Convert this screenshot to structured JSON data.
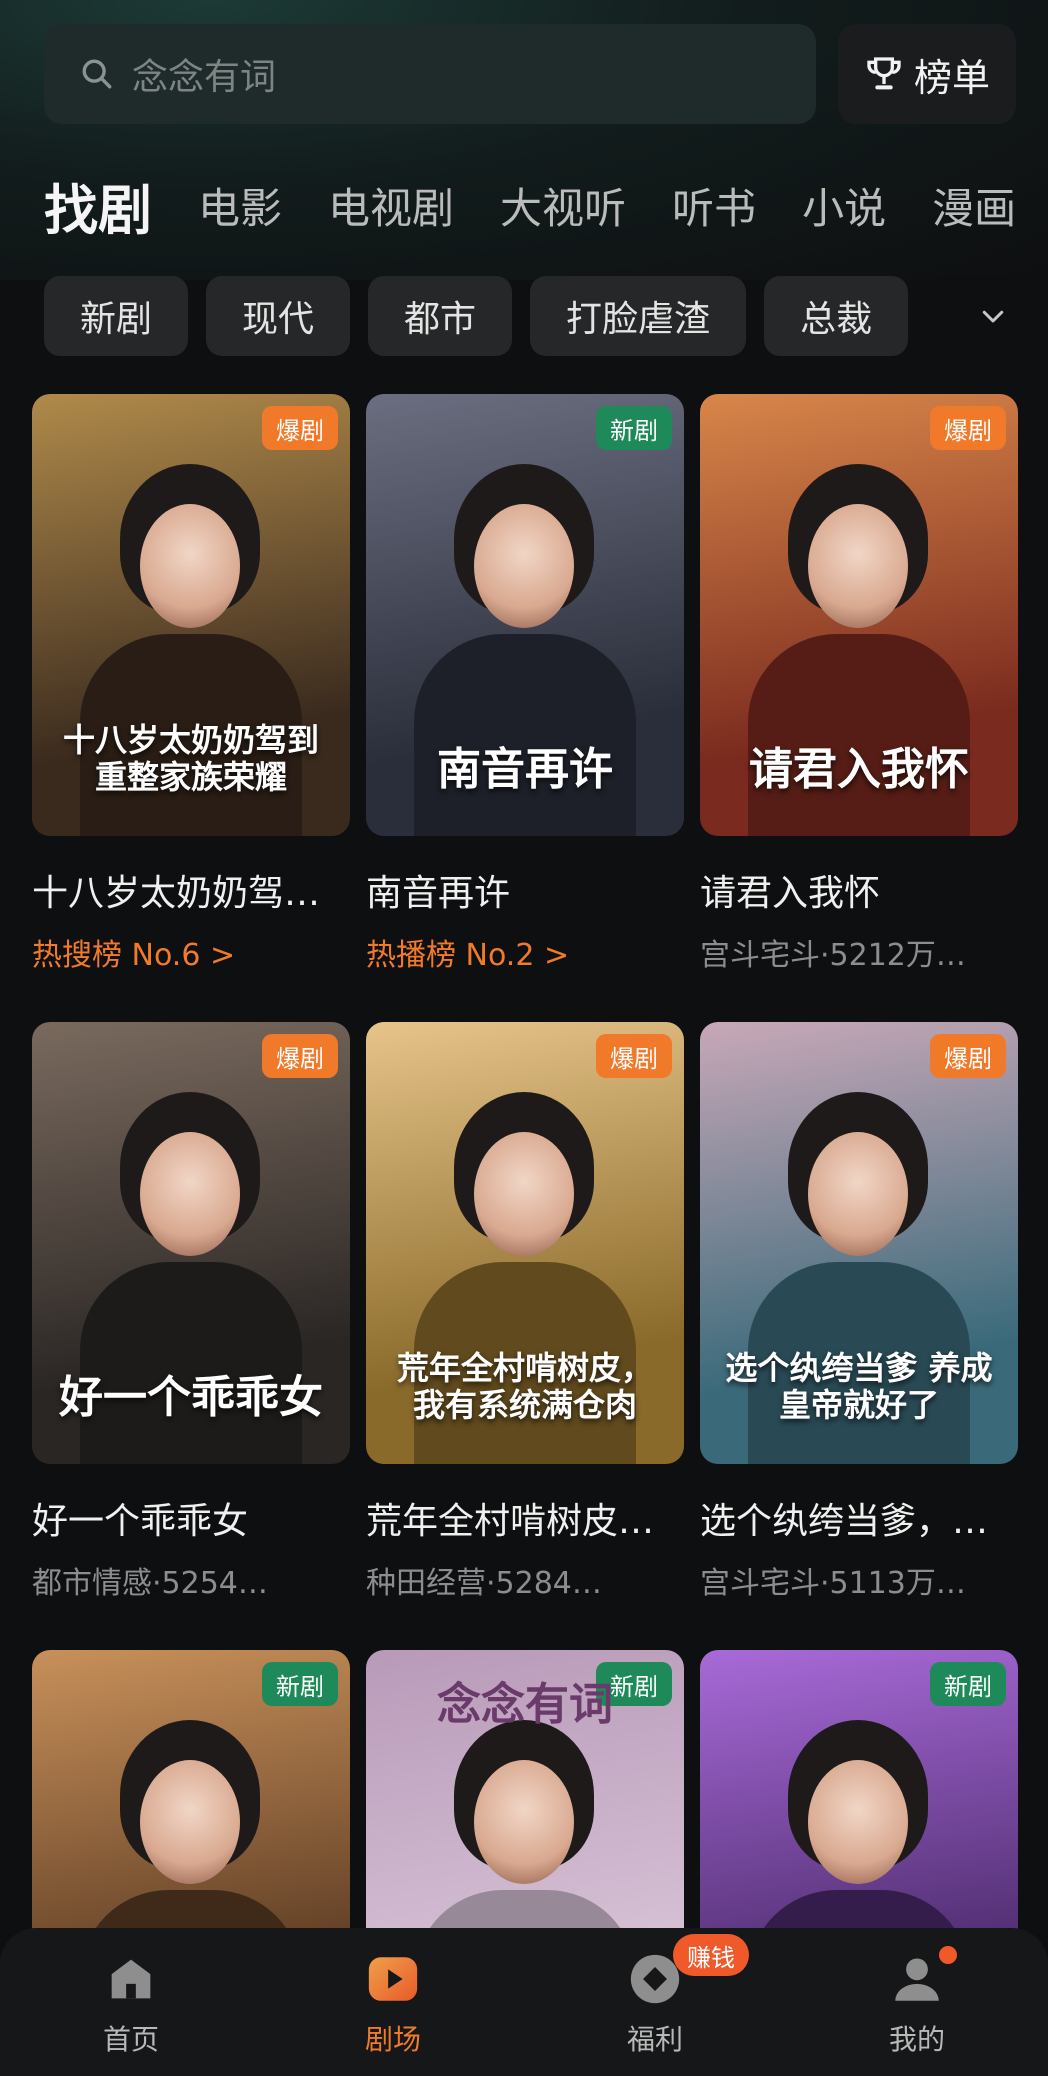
{
  "search": {
    "placeholder": "念念有词"
  },
  "rank_button": {
    "label": "榜单"
  },
  "category_tabs": [
    "找剧",
    "电影",
    "电视剧",
    "大视听",
    "听书",
    "小说",
    "漫画"
  ],
  "filter_chips": [
    "新剧",
    "现代",
    "都市",
    "打脸虐渣",
    "总裁"
  ],
  "cards": [
    {
      "title": "十八岁太奶奶驾…",
      "poster_text": "十八岁太奶奶驾到 重整家族荣耀",
      "badge": "爆剧",
      "badge_type": "hot",
      "sub": "热搜榜 No.6 >",
      "sub_type": "rank",
      "colors": [
        "#3a2a1e",
        "#b08a4a"
      ]
    },
    {
      "title": "南音再许",
      "poster_text": "南音再许",
      "badge": "新剧",
      "badge_type": "new",
      "sub": "热播榜 No.2 >",
      "sub_type": "rank",
      "colors": [
        "#2a2e3a",
        "#6a6e80"
      ]
    },
    {
      "title": "请君入我怀",
      "poster_text": "请君入我怀",
      "badge": "爆剧",
      "badge_type": "hot",
      "sub": "宫斗宅斗·5212万…",
      "sub_type": "normal",
      "colors": [
        "#7a2a1e",
        "#d8864a"
      ]
    },
    {
      "title": "好一个乖乖女",
      "poster_text": "好一个乖乖女",
      "badge": "爆剧",
      "badge_type": "hot",
      "sub": "都市情感·5254…",
      "sub_type": "normal",
      "colors": [
        "#2a2624",
        "#7a6a5e"
      ]
    },
    {
      "title": "荒年全村啃树皮…",
      "poster_text": "荒年全村啃树皮，我有系统满仓肉",
      "badge": "爆剧",
      "badge_type": "hot",
      "sub": "种田经营·5284…",
      "sub_type": "normal",
      "colors": [
        "#8a6a2a",
        "#e6c48a"
      ]
    },
    {
      "title": "选个纨绔当爹，…",
      "poster_text": "选个纨绔当爹 养成皇帝就好了",
      "badge": "爆剧",
      "badge_type": "hot",
      "sub": "宫斗宅斗·5113万…",
      "sub_type": "normal",
      "colors": [
        "#3a6a7a",
        "#c8a8b8"
      ]
    },
    {
      "title": "",
      "poster_text": "",
      "badge": "新剧",
      "badge_type": "new",
      "sub": "",
      "sub_type": "normal",
      "colors": [
        "#5a3a22",
        "#c8905a"
      ]
    },
    {
      "title": "",
      "poster_text": "念念有词",
      "badge": "新剧",
      "badge_type": "new",
      "sub": "",
      "sub_type": "normal",
      "colors": [
        "#d8c4d8",
        "#b89ab8"
      ]
    },
    {
      "title": "",
      "poster_text": "",
      "badge": "新剧",
      "badge_type": "new",
      "sub": "",
      "sub_type": "normal",
      "colors": [
        "#4a2a6a",
        "#a86ad8"
      ]
    }
  ],
  "bottom_nav": [
    {
      "label": "首页",
      "icon": "home-icon",
      "active": false
    },
    {
      "label": "剧场",
      "icon": "theater-play-icon",
      "active": true
    },
    {
      "label": "福利",
      "icon": "coin-icon",
      "active": false,
      "badge": "赚钱"
    },
    {
      "label": "我的",
      "icon": "profile-icon",
      "active": false,
      "dot": true
    }
  ],
  "accent_color": "#f07a2a",
  "new_badge_color": "#1e8a5a"
}
